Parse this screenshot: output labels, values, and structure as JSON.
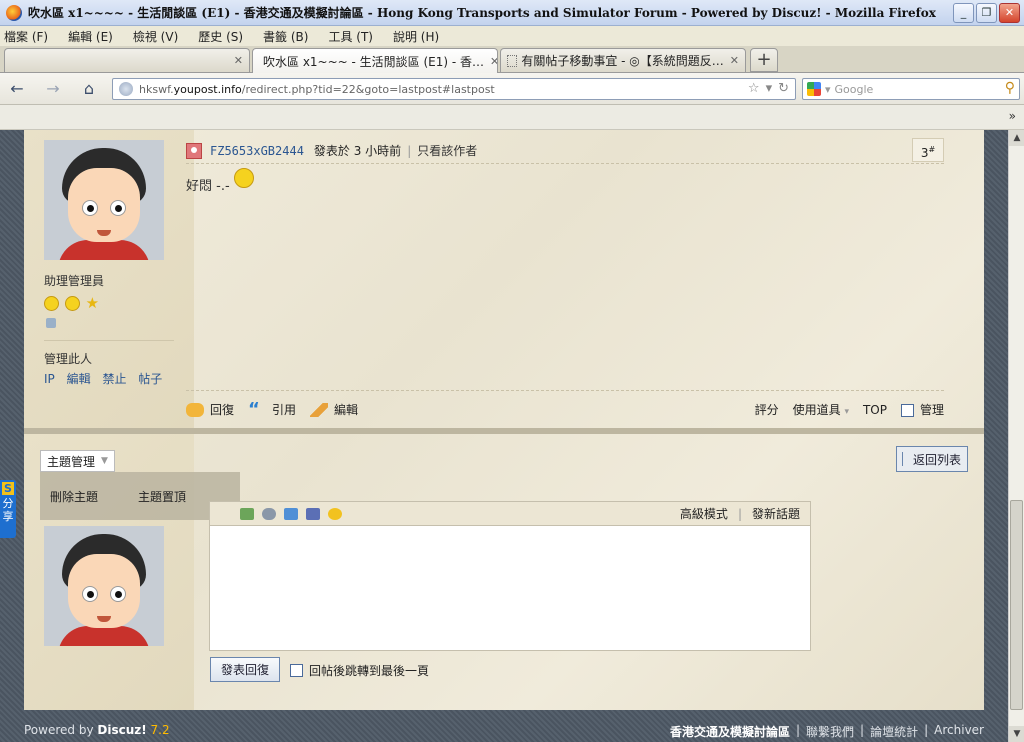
{
  "window": {
    "title": "吹水區 x1~~~~ - 生活閒談區 (E1) - 香港交通及模擬討論區 - Hong Kong Transports and Simulator Forum - Powered by Discuz! - Mozilla Firefox",
    "minimize": "_",
    "restore": "❐",
    "close": "✕"
  },
  "menu": [
    "檔案 (F)",
    "編輯 (E)",
    "檢視 (V)",
    "歷史 (S)",
    "書籤 (B)",
    "工具 (T)",
    "說明 (H)"
  ],
  "tabs": [
    {
      "label": "吹水區 x1~~~ - 生活閒談區 (E1) - 香…"
    },
    {
      "label": "有關帖子移動事宜 - ◎【系統問題反…"
    }
  ],
  "tab_close": "✕",
  "new_tab": "+",
  "nav": {
    "back": "←",
    "forward": "→",
    "home": "⌂",
    "url_prefix": "hkswf.",
    "url_host": "youpost.info",
    "url_path": "/redirect.php?tid=22&goto=lastpost#lastpost",
    "star": "☆",
    "dropdown": "▾",
    "reload": "↻",
    "search_placeholder": "Google",
    "search_icon": "⚲"
  },
  "bookmarks_chevron": "»",
  "sidebar": {
    "role": "助理管理員",
    "manage_label": "管理此人",
    "manage_links": [
      "IP",
      "編輯",
      "禁止",
      "帖子"
    ],
    "star_glyph": "★"
  },
  "post": {
    "author": "FZ5653xGB2444",
    "posted": "發表於 3 小時前",
    "sep": "|",
    "only_author": "只看該作者",
    "floor": "3",
    "floor_mark": "#",
    "body": "好悶 -.-",
    "actions": {
      "reply": "回復",
      "quote": "引用",
      "edit": "編輯"
    },
    "quote_glyph": "“",
    "rate": "評分",
    "tools": "使用道具",
    "tools_arrow": "▾",
    "top": "TOP",
    "manage": "管理"
  },
  "thread": {
    "manage_label": "主題管理",
    "manage_arrow": "▼",
    "menu": [
      "刪除主題",
      "主題置頂"
    ],
    "back_to_list": "返回列表"
  },
  "editor": {
    "advanced": "高級模式",
    "sep": "|",
    "new_topic": "發新話題",
    "submit": "發表回復",
    "after_post": "回帖後跳轉到最後一頁"
  },
  "share": {
    "s": "S",
    "label": "分享"
  },
  "footer": {
    "powered_prefix": "Powered by ",
    "brand": "Discuz!",
    "version": " 7.2",
    "site": "香港交通及模擬討論區",
    "links": [
      "聯繫我們",
      "論壇統計",
      "Archiver"
    ],
    "sep": "|"
  },
  "scroll": {
    "up": "▲",
    "down": "▼"
  }
}
